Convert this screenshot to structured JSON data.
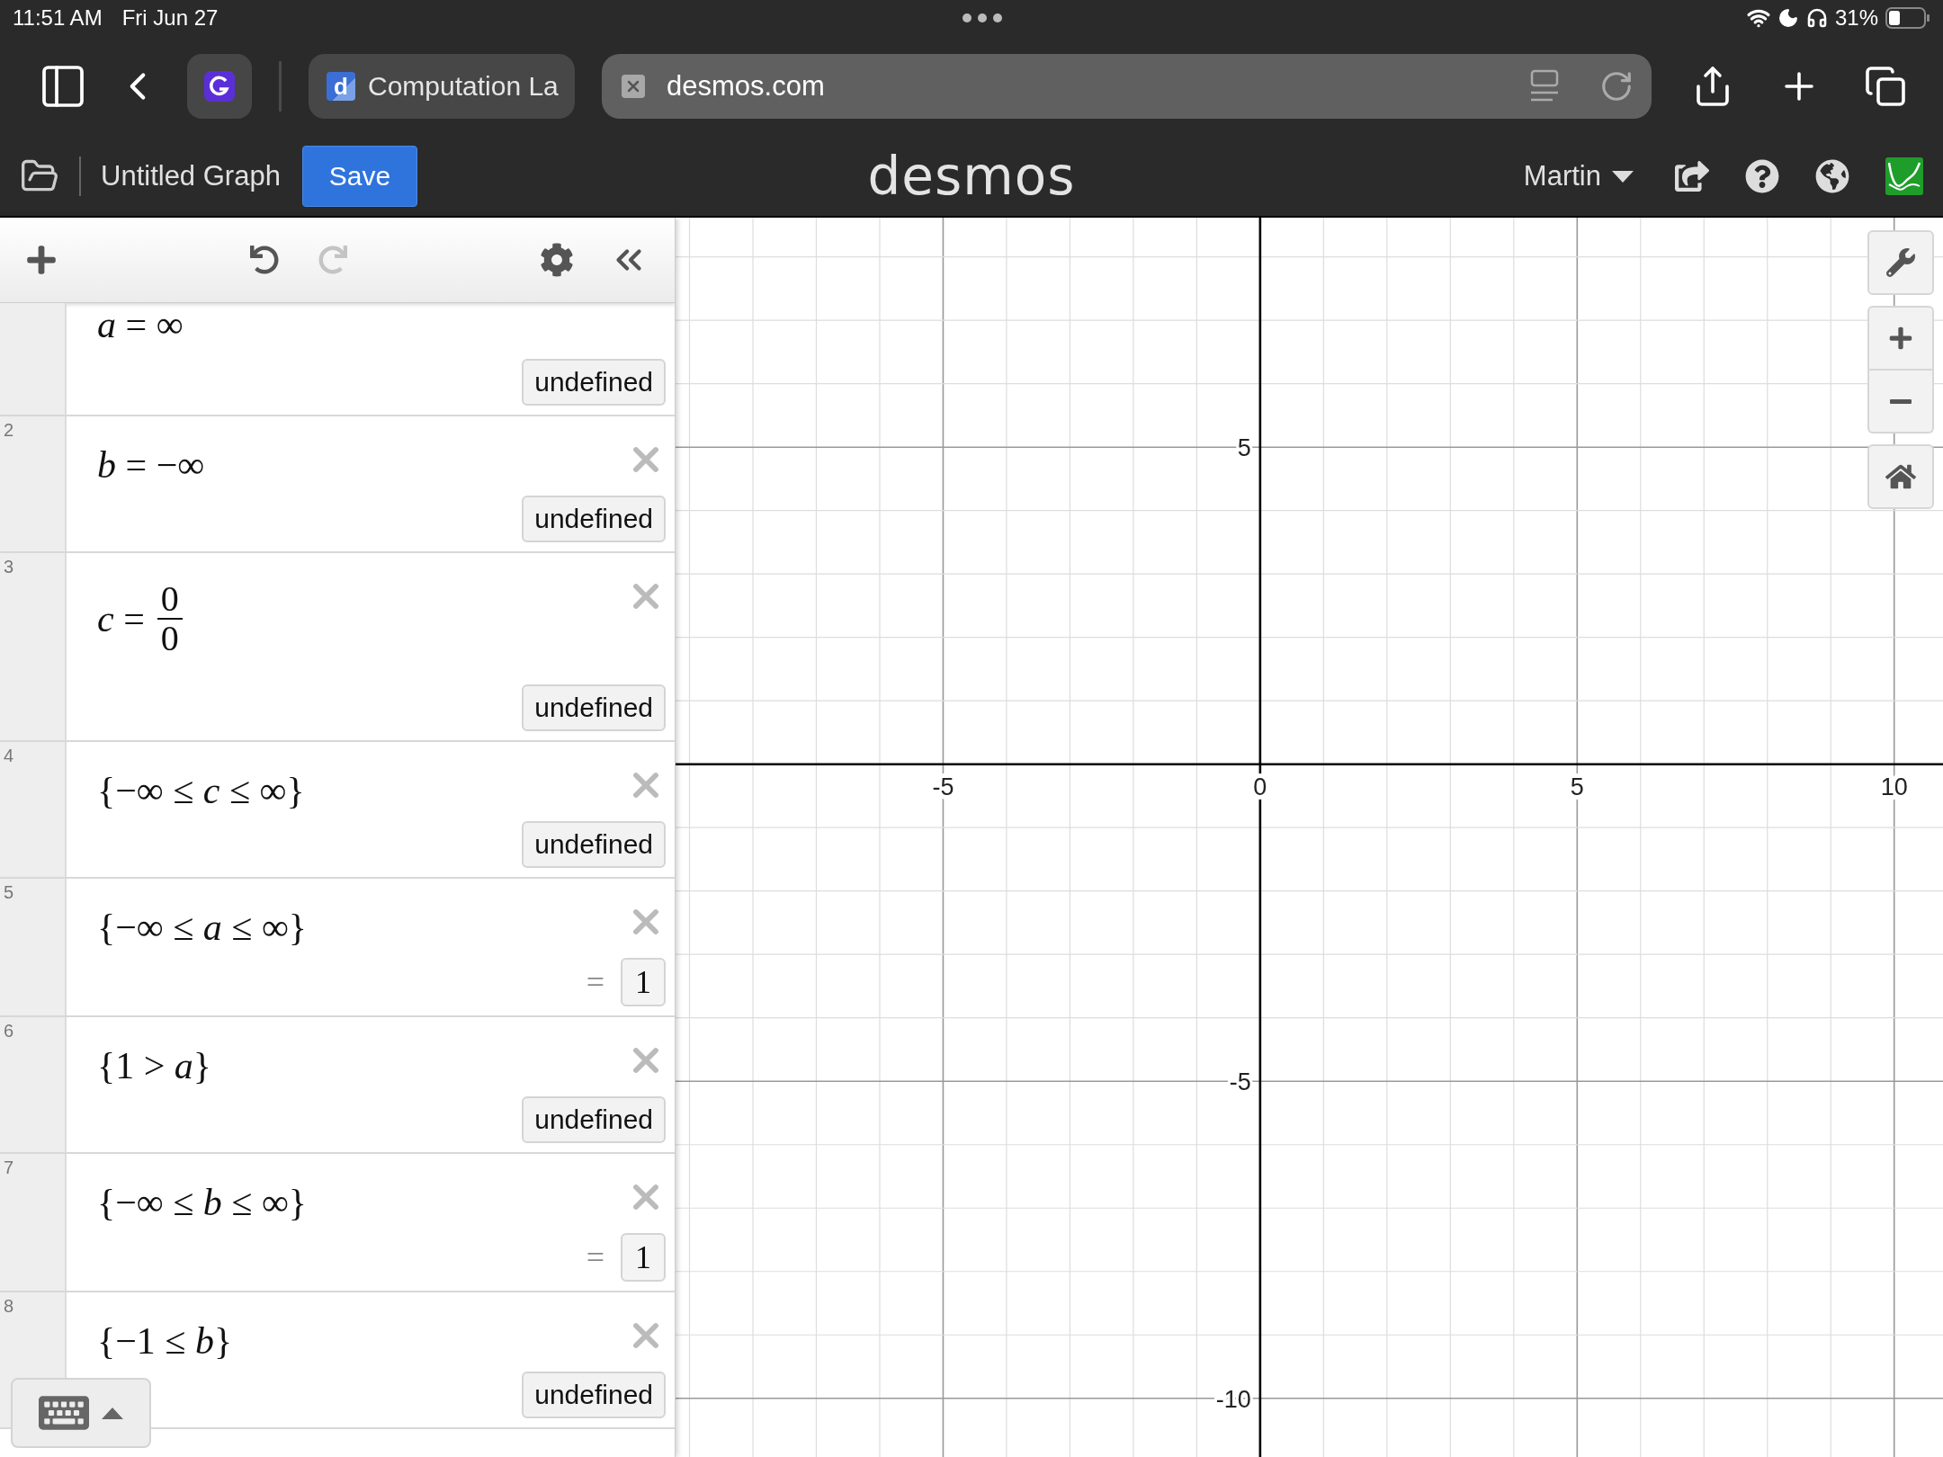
{
  "status_bar": {
    "time": "11:51 AM",
    "date": "Fri Jun 27",
    "battery_text": "31%"
  },
  "browser": {
    "tab": {
      "favicon_letter": "d",
      "title": "Computation La"
    },
    "address": "desmos.com"
  },
  "header": {
    "title": "Untitled Graph",
    "save": "Save",
    "logo": "desmos",
    "user": "Martin"
  },
  "expressions": [
    {
      "kind": "plain",
      "expr": "*a* = ∞",
      "result": {
        "kind": "badge",
        "text": "undefined"
      }
    },
    {
      "kind": "plain",
      "number": "2",
      "expr": "*b* = −∞",
      "result": {
        "kind": "badge",
        "text": "undefined"
      }
    },
    {
      "kind": "fraction",
      "number": "3",
      "lhs": "*c* =",
      "numerator": "0",
      "denominator": "0",
      "result": {
        "kind": "badge",
        "text": "undefined"
      }
    },
    {
      "kind": "plain",
      "number": "4",
      "expr": "{−∞ ≤ *c* ≤ ∞}",
      "result": {
        "kind": "badge",
        "text": "undefined"
      }
    },
    {
      "kind": "plain",
      "number": "5",
      "expr": "{−∞ ≤ *a* ≤ ∞}",
      "result": {
        "kind": "value",
        "prefix": "=",
        "text": "1"
      }
    },
    {
      "kind": "plain",
      "number": "6",
      "expr": "{1 > *a*}",
      "result": {
        "kind": "badge",
        "text": "undefined"
      }
    },
    {
      "kind": "plain",
      "number": "7",
      "expr": "{−∞ ≤ *b* ≤ ∞}",
      "result": {
        "kind": "value",
        "prefix": "=",
        "text": "1"
      }
    },
    {
      "kind": "plain",
      "number": "8",
      "expr": "{−1 ≤ *b*}",
      "result": {
        "kind": "badge",
        "text": "undefined"
      }
    }
  ],
  "graph": {
    "chart_data": {
      "type": "line",
      "xlim": [
        -9.22,
        10.77
      ],
      "ylim": [
        -10.94,
        8.62
      ],
      "xticks": [
        -5,
        0,
        5,
        10
      ],
      "yticks": [
        -10,
        -5,
        5
      ],
      "grid": true
    }
  }
}
